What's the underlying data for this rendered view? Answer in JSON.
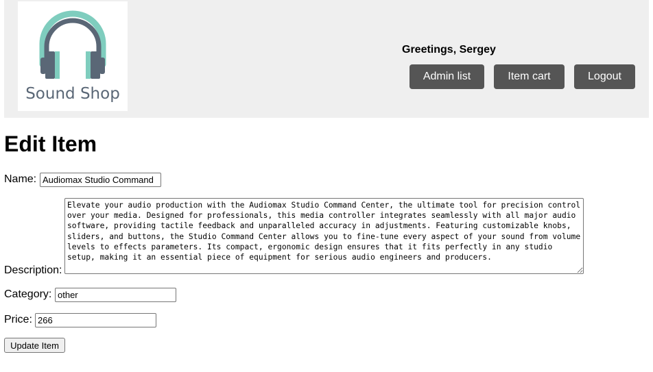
{
  "header": {
    "logo_text": "Sound Shop",
    "greeting": "Greetings, Sergey",
    "nav": {
      "admin_list": "Admin list",
      "item_cart": "Item cart",
      "logout": "Logout"
    }
  },
  "colors": {
    "header_bg": "#efefef",
    "nav_button_bg": "#555555",
    "logo_headphone_dark": "#5a6776",
    "logo_headphone_accent": "#7fcdbe"
  },
  "form": {
    "title": "Edit Item",
    "name_label": "Name:",
    "name_value": "Audiomax Studio Command",
    "description_label": "Description:",
    "description_value": "Elevate your audio production with the Audiomax Studio Command Center, the ultimate tool for precision control over your media. Designed for professionals, this media controller integrates seamlessly with all major audio software, providing tactile feedback and unparalleled accuracy in adjustments. Featuring customizable knobs, sliders, and buttons, the Studio Command Center allows you to fine-tune every aspect of your sound from volume levels to effects parameters. Its compact, ergonomic design ensures that it fits perfectly in any studio setup, making it an essential piece of equipment for serious audio engineers and producers.",
    "category_label": "Category:",
    "category_value": "other",
    "price_label": "Price:",
    "price_value": "266",
    "submit_label": "Update Item"
  }
}
